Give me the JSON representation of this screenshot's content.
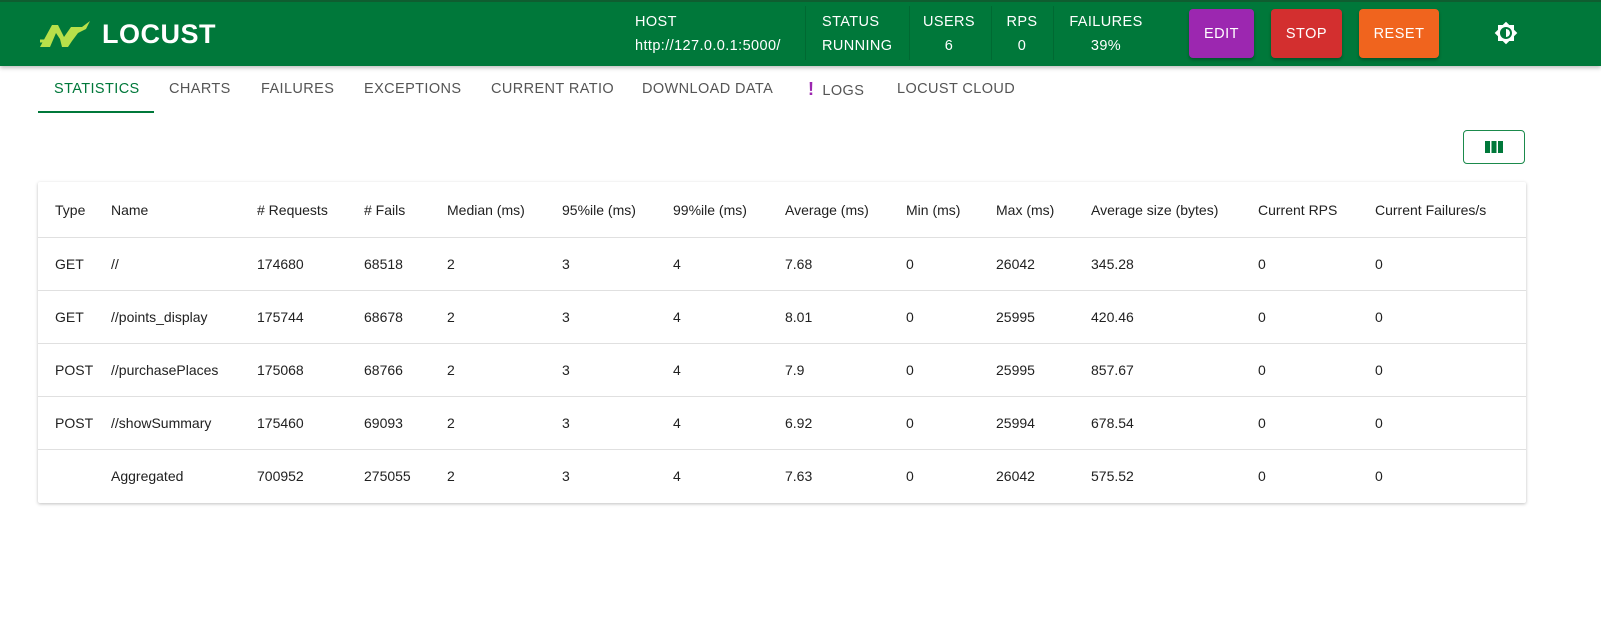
{
  "header": {
    "logo_text": "LOCUST",
    "stats": [
      {
        "label": "HOST",
        "value": "http://127.0.0.1:5000/"
      },
      {
        "label": "STATUS",
        "value": "RUNNING"
      },
      {
        "label": "USERS",
        "value": "6"
      },
      {
        "label": "RPS",
        "value": "0"
      },
      {
        "label": "FAILURES",
        "value": "39%"
      }
    ],
    "buttons": {
      "edit": {
        "label": "EDIT",
        "color": "#9c27b0"
      },
      "stop": {
        "label": "STOP",
        "color": "#d32f2f"
      },
      "reset": {
        "label": "RESET",
        "color": "#f0641e"
      }
    },
    "theme_icon": "brightness-icon",
    "brand_color": "#00783a"
  },
  "tabs": [
    {
      "label": "STATISTICS",
      "active": true
    },
    {
      "label": "CHARTS"
    },
    {
      "label": "FAILURES"
    },
    {
      "label": "EXCEPTIONS"
    },
    {
      "label": "CURRENT RATIO"
    },
    {
      "label": "DOWNLOAD DATA"
    },
    {
      "label": "LOGS",
      "alert": "!"
    },
    {
      "label": "LOCUST CLOUD"
    }
  ],
  "columns_button_icon": "view-column-icon",
  "table": {
    "headers": [
      "Type",
      "Name",
      "# Requests",
      "# Fails",
      "Median (ms)",
      "95%ile (ms)",
      "99%ile (ms)",
      "Average (ms)",
      "Min (ms)",
      "Max (ms)",
      "Average size (bytes)",
      "Current RPS",
      "Current Failures/s"
    ],
    "rows": [
      [
        "GET",
        "//",
        "174680",
        "68518",
        "2",
        "3",
        "4",
        "7.68",
        "0",
        "26042",
        "345.28",
        "0",
        "0"
      ],
      [
        "GET",
        "//points_display",
        "175744",
        "68678",
        "2",
        "3",
        "4",
        "8.01",
        "0",
        "25995",
        "420.46",
        "0",
        "0"
      ],
      [
        "POST",
        "//purchasePlaces",
        "175068",
        "68766",
        "2",
        "3",
        "4",
        "7.9",
        "0",
        "25995",
        "857.67",
        "0",
        "0"
      ],
      [
        "POST",
        "//showSummary",
        "175460",
        "69093",
        "2",
        "3",
        "4",
        "6.92",
        "0",
        "25994",
        "678.54",
        "0",
        "0"
      ],
      [
        "",
        "Aggregated",
        "700952",
        "275055",
        "2",
        "3",
        "4",
        "7.63",
        "0",
        "26042",
        "575.52",
        "0",
        "0"
      ]
    ]
  }
}
